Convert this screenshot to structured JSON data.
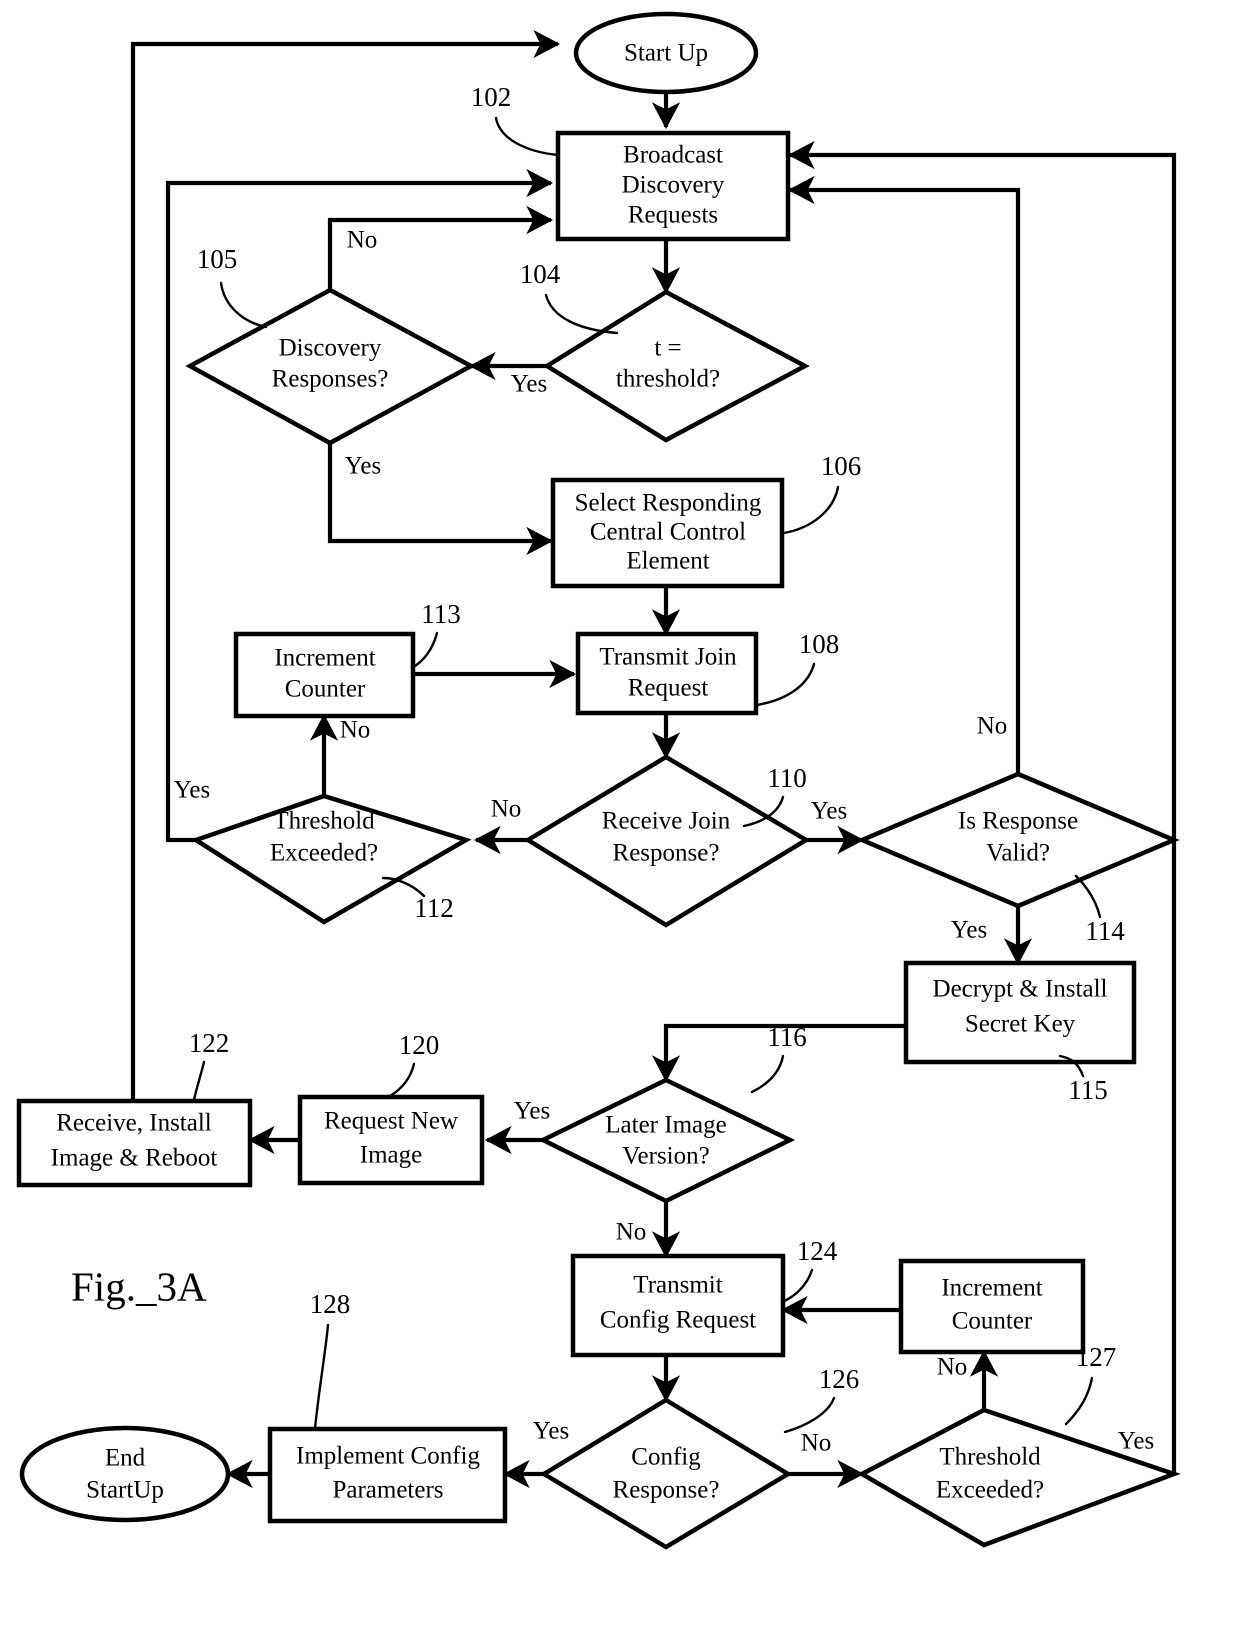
{
  "figure": {
    "label": "Fig._3A",
    "title": "Start Up flowchart"
  },
  "nodes": {
    "start": {
      "text": "Start Up",
      "type": "terminator"
    },
    "broadcast": {
      "line1": "Broadcast",
      "line2": "Discovery",
      "line3": "Requests",
      "ref": "102",
      "type": "process"
    },
    "threshold_t": {
      "line1": "t =",
      "line2": "threshold?",
      "ref": "104",
      "type": "decision"
    },
    "discovery_responses": {
      "line1": "Discovery",
      "line2": "Responses?",
      "ref": "105",
      "type": "decision"
    },
    "select_cce": {
      "line1": "Select Responding",
      "line2": "Central Control",
      "line3": "Element",
      "ref": "106",
      "type": "process"
    },
    "transmit_join": {
      "line1": "Transmit Join",
      "line2": "Request",
      "ref": "108",
      "type": "process"
    },
    "increment_counter_1": {
      "line1": "Increment",
      "line2": "Counter",
      "ref": "113",
      "type": "process"
    },
    "receive_join_response": {
      "line1": "Receive Join",
      "line2": "Response?",
      "ref": "110",
      "type": "decision"
    },
    "threshold_exceeded_1": {
      "line1": "Threshold",
      "line2": "Exceeded?",
      "ref": "112",
      "type": "decision"
    },
    "is_response_valid": {
      "line1": "Is Response",
      "line2": "Valid?",
      "ref": "114",
      "type": "decision"
    },
    "decrypt_install": {
      "line1": "Decrypt & Install",
      "line2": "Secret Key",
      "ref": "115",
      "type": "process"
    },
    "later_image_version": {
      "line1": "Later Image",
      "line2": "Version?",
      "ref": "116",
      "type": "decision"
    },
    "request_new_image": {
      "line1": "Request New",
      "line2": "Image",
      "ref": "120",
      "type": "process"
    },
    "receive_install_reboot": {
      "line1": "Receive, Install",
      "line2": "Image & Reboot",
      "ref": "122",
      "type": "process"
    },
    "transmit_config": {
      "line1": "Transmit",
      "line2": "Config Request",
      "ref": "124",
      "type": "process"
    },
    "increment_counter_2": {
      "line1": "Increment",
      "line2": "Counter",
      "type": "process"
    },
    "config_response": {
      "line1": "Config",
      "line2": "Response?",
      "ref": "126",
      "type": "decision"
    },
    "threshold_exceeded_2": {
      "line1": "Threshold",
      "line2": "Exceeded?",
      "ref": "127",
      "type": "decision"
    },
    "implement_config": {
      "line1": "Implement Config",
      "line2": "Parameters",
      "ref": "128",
      "type": "process"
    },
    "end": {
      "line1": "End",
      "line2": "StartUp",
      "type": "terminator"
    }
  },
  "edge_labels": {
    "t_threshold_yes": "Yes",
    "discovery_no": "No",
    "discovery_yes": "Yes",
    "threshold1_no": "No",
    "threshold1_yes": "Yes",
    "join_response_no": "No",
    "join_response_yes": "Yes",
    "valid_no": "No",
    "valid_yes": "Yes",
    "later_image_yes": "Yes",
    "later_image_no": "No",
    "config_response_yes": "Yes",
    "config_response_no": "No",
    "threshold2_no": "No",
    "threshold2_yes": "Yes"
  },
  "colors": {
    "ink": "#000000",
    "paper": "#ffffff"
  }
}
